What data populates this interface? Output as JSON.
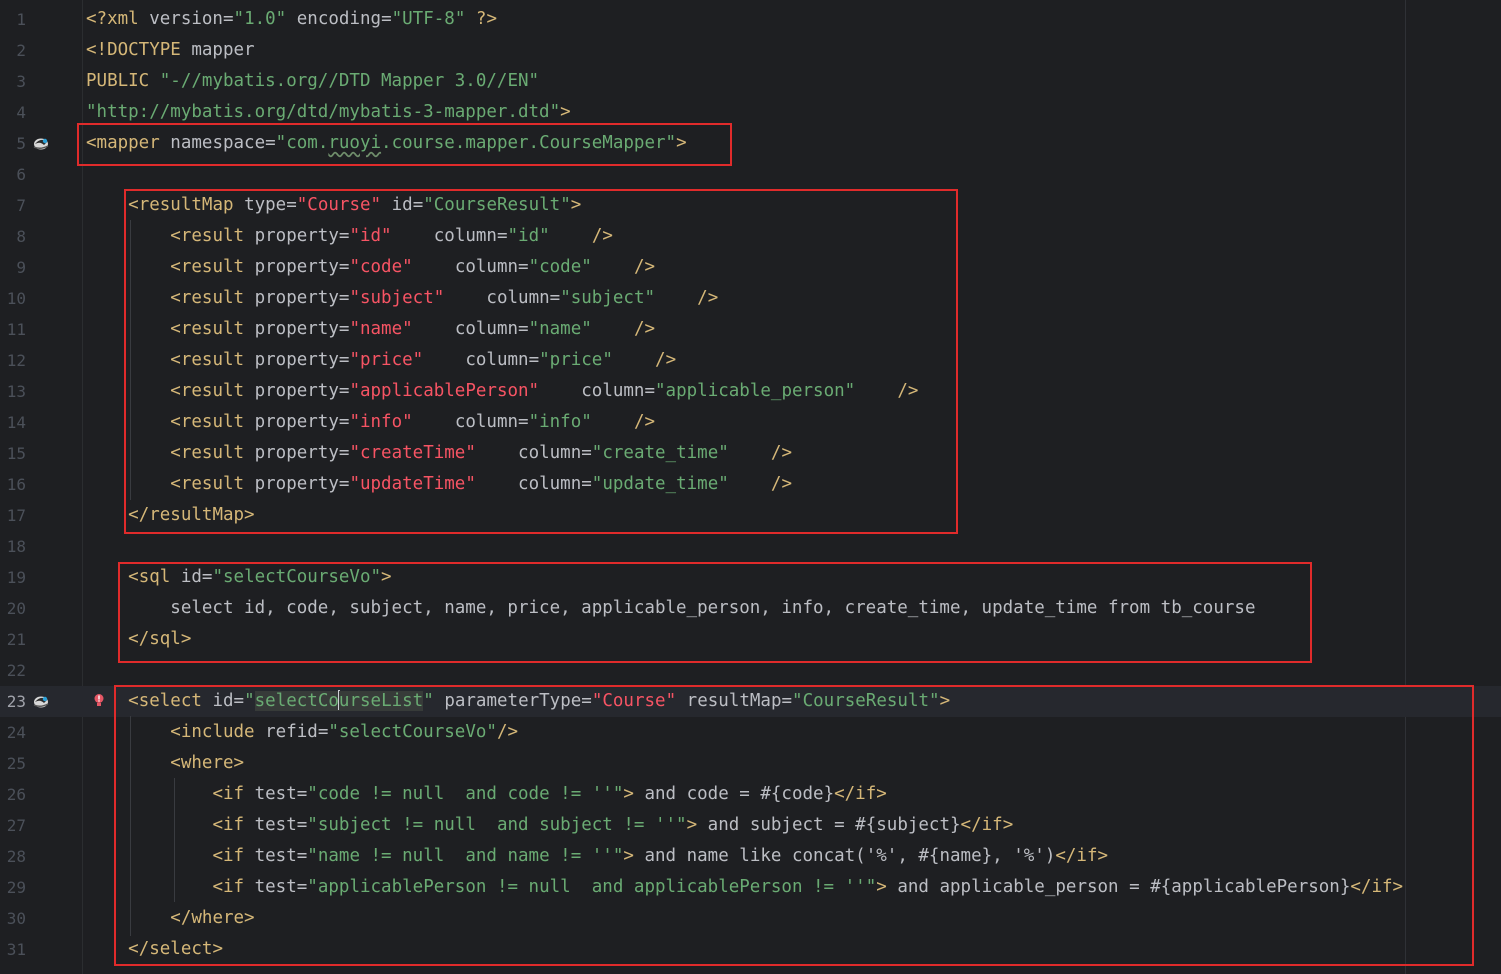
{
  "editor": {
    "lines": [
      {
        "n": "1",
        "tokens": [
          {
            "c": "t",
            "v": "<?xml "
          },
          {
            "c": "a",
            "v": "version"
          },
          {
            "c": "p",
            "v": "="
          },
          {
            "c": "s",
            "v": "\"1.0\""
          },
          {
            "c": "p",
            "v": " "
          },
          {
            "c": "a",
            "v": "encoding"
          },
          {
            "c": "p",
            "v": "="
          },
          {
            "c": "s",
            "v": "\"UTF-8\""
          },
          {
            "c": "p",
            "v": " "
          },
          {
            "c": "t",
            "v": "?>"
          }
        ]
      },
      {
        "n": "2",
        "tokens": [
          {
            "c": "t",
            "v": "<!DOCTYPE "
          },
          {
            "c": "a",
            "v": "mapper"
          }
        ]
      },
      {
        "n": "3",
        "tokens": [
          {
            "c": "t",
            "v": "PUBLIC "
          },
          {
            "c": "s",
            "v": "\"-//mybatis.org//DTD Mapper 3.0//EN\""
          }
        ]
      },
      {
        "n": "4",
        "tokens": [
          {
            "c": "s",
            "v": "\"http://mybatis.org/dtd/mybatis-3-mapper.dtd\""
          },
          {
            "c": "t",
            "v": ">"
          }
        ]
      },
      {
        "n": "5",
        "tokens": [
          {
            "c": "t",
            "v": "<mapper "
          },
          {
            "c": "a",
            "v": "namespace"
          },
          {
            "c": "p",
            "v": "="
          },
          {
            "c": "s",
            "v": "\"com."
          },
          {
            "c": "s squiggle",
            "v": "ruoyi"
          },
          {
            "c": "s",
            "v": ".course.mapper.CourseMapper\""
          },
          {
            "c": "t",
            "v": ">"
          }
        ]
      },
      {
        "n": "6",
        "tokens": []
      },
      {
        "n": "7",
        "tokens": [
          {
            "c": "p",
            "v": "    "
          },
          {
            "c": "t",
            "v": "<resultMap "
          },
          {
            "c": "a",
            "v": "type"
          },
          {
            "c": "p",
            "v": "="
          },
          {
            "c": "r",
            "v": "\"Course\""
          },
          {
            "c": "p",
            "v": " "
          },
          {
            "c": "a",
            "v": "id"
          },
          {
            "c": "p",
            "v": "="
          },
          {
            "c": "s",
            "v": "\"CourseResult\""
          },
          {
            "c": "t",
            "v": ">"
          }
        ]
      },
      {
        "n": "8",
        "tokens": [
          {
            "c": "p",
            "v": "        "
          },
          {
            "c": "t",
            "v": "<result "
          },
          {
            "c": "a",
            "v": "property"
          },
          {
            "c": "p",
            "v": "="
          },
          {
            "c": "r",
            "v": "\"id\""
          },
          {
            "c": "p",
            "v": "    "
          },
          {
            "c": "a",
            "v": "column"
          },
          {
            "c": "p",
            "v": "="
          },
          {
            "c": "s",
            "v": "\"id\""
          },
          {
            "c": "p",
            "v": "    "
          },
          {
            "c": "t",
            "v": "/>"
          }
        ]
      },
      {
        "n": "9",
        "tokens": [
          {
            "c": "p",
            "v": "        "
          },
          {
            "c": "t",
            "v": "<result "
          },
          {
            "c": "a",
            "v": "property"
          },
          {
            "c": "p",
            "v": "="
          },
          {
            "c": "r",
            "v": "\"code\""
          },
          {
            "c": "p",
            "v": "    "
          },
          {
            "c": "a",
            "v": "column"
          },
          {
            "c": "p",
            "v": "="
          },
          {
            "c": "s",
            "v": "\"code\""
          },
          {
            "c": "p",
            "v": "    "
          },
          {
            "c": "t",
            "v": "/>"
          }
        ]
      },
      {
        "n": "10",
        "tokens": [
          {
            "c": "p",
            "v": "        "
          },
          {
            "c": "t",
            "v": "<result "
          },
          {
            "c": "a",
            "v": "property"
          },
          {
            "c": "p",
            "v": "="
          },
          {
            "c": "r",
            "v": "\"subject\""
          },
          {
            "c": "p",
            "v": "    "
          },
          {
            "c": "a",
            "v": "column"
          },
          {
            "c": "p",
            "v": "="
          },
          {
            "c": "s",
            "v": "\"subject\""
          },
          {
            "c": "p",
            "v": "    "
          },
          {
            "c": "t",
            "v": "/>"
          }
        ]
      },
      {
        "n": "11",
        "tokens": [
          {
            "c": "p",
            "v": "        "
          },
          {
            "c": "t",
            "v": "<result "
          },
          {
            "c": "a",
            "v": "property"
          },
          {
            "c": "p",
            "v": "="
          },
          {
            "c": "r",
            "v": "\"name\""
          },
          {
            "c": "p",
            "v": "    "
          },
          {
            "c": "a",
            "v": "column"
          },
          {
            "c": "p",
            "v": "="
          },
          {
            "c": "s",
            "v": "\"name\""
          },
          {
            "c": "p",
            "v": "    "
          },
          {
            "c": "t",
            "v": "/>"
          }
        ]
      },
      {
        "n": "12",
        "tokens": [
          {
            "c": "p",
            "v": "        "
          },
          {
            "c": "t",
            "v": "<result "
          },
          {
            "c": "a",
            "v": "property"
          },
          {
            "c": "p",
            "v": "="
          },
          {
            "c": "r",
            "v": "\"price\""
          },
          {
            "c": "p",
            "v": "    "
          },
          {
            "c": "a",
            "v": "column"
          },
          {
            "c": "p",
            "v": "="
          },
          {
            "c": "s",
            "v": "\"price\""
          },
          {
            "c": "p",
            "v": "    "
          },
          {
            "c": "t",
            "v": "/>"
          }
        ]
      },
      {
        "n": "13",
        "tokens": [
          {
            "c": "p",
            "v": "        "
          },
          {
            "c": "t",
            "v": "<result "
          },
          {
            "c": "a",
            "v": "property"
          },
          {
            "c": "p",
            "v": "="
          },
          {
            "c": "r",
            "v": "\"applicablePerson\""
          },
          {
            "c": "p",
            "v": "    "
          },
          {
            "c": "a",
            "v": "column"
          },
          {
            "c": "p",
            "v": "="
          },
          {
            "c": "s",
            "v": "\"applicable_person\""
          },
          {
            "c": "p",
            "v": "    "
          },
          {
            "c": "t",
            "v": "/>"
          }
        ]
      },
      {
        "n": "14",
        "tokens": [
          {
            "c": "p",
            "v": "        "
          },
          {
            "c": "t",
            "v": "<result "
          },
          {
            "c": "a",
            "v": "property"
          },
          {
            "c": "p",
            "v": "="
          },
          {
            "c": "r",
            "v": "\"info\""
          },
          {
            "c": "p",
            "v": "    "
          },
          {
            "c": "a",
            "v": "column"
          },
          {
            "c": "p",
            "v": "="
          },
          {
            "c": "s",
            "v": "\"info\""
          },
          {
            "c": "p",
            "v": "    "
          },
          {
            "c": "t",
            "v": "/>"
          }
        ]
      },
      {
        "n": "15",
        "tokens": [
          {
            "c": "p",
            "v": "        "
          },
          {
            "c": "t",
            "v": "<result "
          },
          {
            "c": "a",
            "v": "property"
          },
          {
            "c": "p",
            "v": "="
          },
          {
            "c": "r",
            "v": "\"createTime\""
          },
          {
            "c": "p",
            "v": "    "
          },
          {
            "c": "a",
            "v": "column"
          },
          {
            "c": "p",
            "v": "="
          },
          {
            "c": "s",
            "v": "\"create_time\""
          },
          {
            "c": "p",
            "v": "    "
          },
          {
            "c": "t",
            "v": "/>"
          }
        ]
      },
      {
        "n": "16",
        "tokens": [
          {
            "c": "p",
            "v": "        "
          },
          {
            "c": "t",
            "v": "<result "
          },
          {
            "c": "a",
            "v": "property"
          },
          {
            "c": "p",
            "v": "="
          },
          {
            "c": "r",
            "v": "\"updateTime\""
          },
          {
            "c": "p",
            "v": "    "
          },
          {
            "c": "a",
            "v": "column"
          },
          {
            "c": "p",
            "v": "="
          },
          {
            "c": "s",
            "v": "\"update_time\""
          },
          {
            "c": "p",
            "v": "    "
          },
          {
            "c": "t",
            "v": "/>"
          }
        ]
      },
      {
        "n": "17",
        "tokens": [
          {
            "c": "p",
            "v": "    "
          },
          {
            "c": "t",
            "v": "</resultMap>"
          }
        ]
      },
      {
        "n": "18",
        "tokens": []
      },
      {
        "n": "19",
        "tokens": [
          {
            "c": "p",
            "v": "    "
          },
          {
            "c": "t",
            "v": "<sql "
          },
          {
            "c": "a",
            "v": "id"
          },
          {
            "c": "p",
            "v": "="
          },
          {
            "c": "s",
            "v": "\"selectCourseVo\""
          },
          {
            "c": "t",
            "v": ">"
          }
        ]
      },
      {
        "n": "20",
        "tokens": [
          {
            "c": "p",
            "v": "        select id, code, subject, name, price, applicable_person, info, create_time, update_time from tb_course"
          }
        ]
      },
      {
        "n": "21",
        "tokens": [
          {
            "c": "p",
            "v": "    "
          },
          {
            "c": "t",
            "v": "</sql>"
          }
        ]
      },
      {
        "n": "22",
        "tokens": []
      },
      {
        "n": "23",
        "current": true,
        "tokens": [
          {
            "c": "p",
            "v": "    "
          },
          {
            "c": "t",
            "v": "<select "
          },
          {
            "c": "a",
            "v": "id"
          },
          {
            "c": "p",
            "v": "="
          },
          {
            "c": "s",
            "v": "\""
          },
          {
            "c": "s sel-hl",
            "v": "selectCo"
          },
          {
            "c": "caret",
            "v": ""
          },
          {
            "c": "s sel-hl",
            "v": "urseList"
          },
          {
            "c": "s",
            "v": "\""
          },
          {
            "c": "p",
            "v": " "
          },
          {
            "c": "a",
            "v": "parameterType"
          },
          {
            "c": "p",
            "v": "="
          },
          {
            "c": "r",
            "v": "\"Course\""
          },
          {
            "c": "p",
            "v": " "
          },
          {
            "c": "a",
            "v": "resultMap"
          },
          {
            "c": "p",
            "v": "="
          },
          {
            "c": "s",
            "v": "\"CourseResult\""
          },
          {
            "c": "t",
            "v": ">"
          }
        ]
      },
      {
        "n": "24",
        "tokens": [
          {
            "c": "p",
            "v": "        "
          },
          {
            "c": "t",
            "v": "<include "
          },
          {
            "c": "a",
            "v": "refid"
          },
          {
            "c": "p",
            "v": "="
          },
          {
            "c": "s",
            "v": "\"selectCourseVo\""
          },
          {
            "c": "t",
            "v": "/>"
          }
        ]
      },
      {
        "n": "25",
        "tokens": [
          {
            "c": "p",
            "v": "        "
          },
          {
            "c": "t",
            "v": "<where>"
          }
        ]
      },
      {
        "n": "26",
        "tokens": [
          {
            "c": "p",
            "v": "            "
          },
          {
            "c": "t",
            "v": "<if "
          },
          {
            "c": "a",
            "v": "test"
          },
          {
            "c": "p",
            "v": "="
          },
          {
            "c": "s",
            "v": "\"code != null  and code != ''\""
          },
          {
            "c": "t",
            "v": ">"
          },
          {
            "c": "p",
            "v": " and code = #{code}"
          },
          {
            "c": "t",
            "v": "</if>"
          }
        ]
      },
      {
        "n": "27",
        "tokens": [
          {
            "c": "p",
            "v": "            "
          },
          {
            "c": "t",
            "v": "<if "
          },
          {
            "c": "a",
            "v": "test"
          },
          {
            "c": "p",
            "v": "="
          },
          {
            "c": "s",
            "v": "\"subject != null  and subject != ''\""
          },
          {
            "c": "t",
            "v": ">"
          },
          {
            "c": "p",
            "v": " and subject = #{subject}"
          },
          {
            "c": "t",
            "v": "</if>"
          }
        ]
      },
      {
        "n": "28",
        "tokens": [
          {
            "c": "p",
            "v": "            "
          },
          {
            "c": "t",
            "v": "<if "
          },
          {
            "c": "a",
            "v": "test"
          },
          {
            "c": "p",
            "v": "="
          },
          {
            "c": "s",
            "v": "\"name != null  and name != ''\""
          },
          {
            "c": "t",
            "v": ">"
          },
          {
            "c": "p",
            "v": " and name like concat('%', #{name}, '%')"
          },
          {
            "c": "t",
            "v": "</if>"
          }
        ]
      },
      {
        "n": "29",
        "tokens": [
          {
            "c": "p",
            "v": "            "
          },
          {
            "c": "t",
            "v": "<if "
          },
          {
            "c": "a",
            "v": "test"
          },
          {
            "c": "p",
            "v": "="
          },
          {
            "c": "s",
            "v": "\"applicablePerson != null  and applicablePerson != ''\""
          },
          {
            "c": "t",
            "v": ">"
          },
          {
            "c": "p",
            "v": " and applicable_person = #{applicablePerson}"
          },
          {
            "c": "t",
            "v": "</if>"
          }
        ]
      },
      {
        "n": "30",
        "tokens": [
          {
            "c": "p",
            "v": "        "
          },
          {
            "c": "t",
            "v": "</where>"
          }
        ]
      },
      {
        "n": "31",
        "tokens": [
          {
            "c": "p",
            "v": "    "
          },
          {
            "c": "t",
            "v": "</select>"
          }
        ]
      }
    ],
    "gutter_icons": [
      {
        "line": "5",
        "icon": "mybatis-bird-icon"
      },
      {
        "line": "23",
        "icon": "mybatis-bird-icon"
      }
    ],
    "intention_icon": {
      "line": "23",
      "icon": "lightbulb-error-icon"
    },
    "highlight_color": "#e02b2b"
  }
}
